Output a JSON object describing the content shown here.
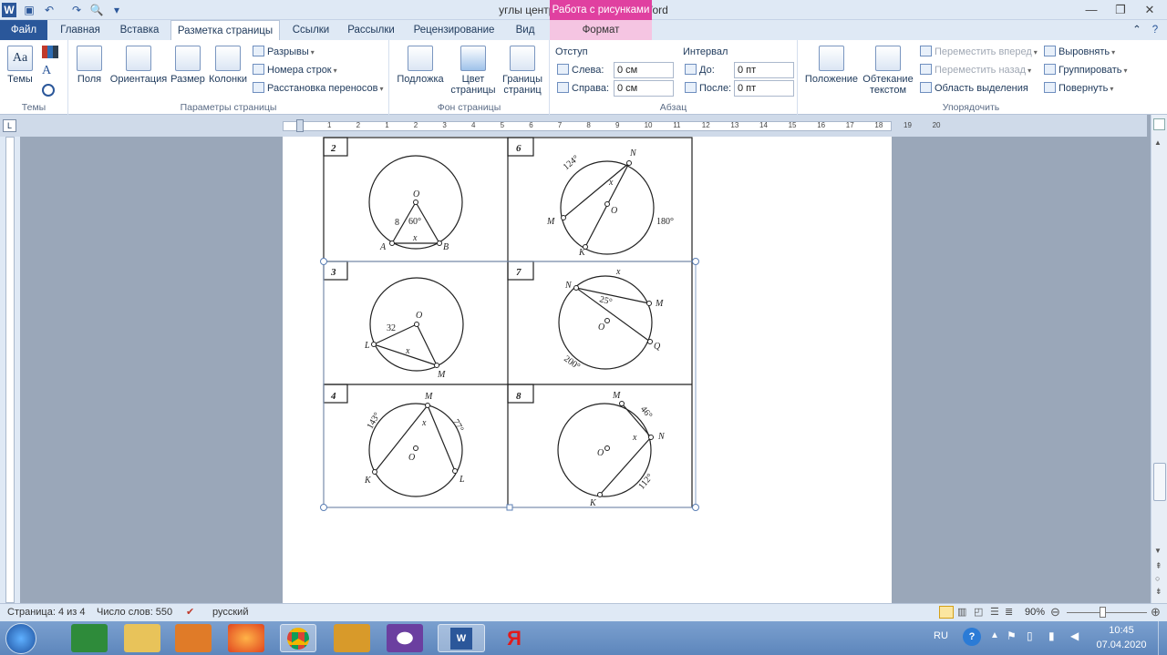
{
  "window": {
    "title": "углы централь. 8  -  Microsoft Word",
    "context_header": "Работа с рисунками"
  },
  "tabs": [
    "Файл",
    "Главная",
    "Вставка",
    "Разметка страницы",
    "Ссылки",
    "Рассылки",
    "Рецензирование",
    "Вид",
    "Формат"
  ],
  "ribbon": {
    "themes": {
      "themes_label": "Темы",
      "group": "Темы"
    },
    "page_setup": {
      "fields": "Поля",
      "orientation": "Ориентация",
      "size": "Размер",
      "columns": "Колонки",
      "breaks": "Разрывы",
      "line_numbers": "Номера строк",
      "hyphenation": "Расстановка переносов",
      "group": "Параметры страницы"
    },
    "page_background": {
      "watermark": "Подложка",
      "color1": "Цвет",
      "color2": "страницы",
      "borders1": "Границы",
      "borders2": "страниц",
      "group": "Фон страницы"
    },
    "paragraph": {
      "indent_title": "Отступ",
      "left_label": "Слева:",
      "left_value": "0 см",
      "right_label": "Справа:",
      "right_value": "0 см",
      "spacing_title": "Интервал",
      "before_label": "До:",
      "before_value": "0 пт",
      "after_label": "После:",
      "after_value": "0 пт",
      "group": "Абзац"
    },
    "arrange": {
      "position": "Положение",
      "wrap1": "Обтекание",
      "wrap2": "текстом",
      "bring_forward": "Переместить вперед",
      "send_backward": "Переместить назад",
      "selection_pane": "Область выделения",
      "align": "Выровнять",
      "group_cmd": "Группировать",
      "rotate": "Повернуть",
      "group": "Упорядочить"
    }
  },
  "ruler_numbers": [
    "1",
    "2",
    "1",
    "2",
    "3",
    "4",
    "5",
    "6",
    "7",
    "8",
    "9",
    "10",
    "11",
    "12",
    "13",
    "14",
    "15",
    "16",
    "17",
    "18",
    "19",
    "20"
  ],
  "figure": {
    "cells": [
      {
        "num": "2",
        "labels": {
          "O": "O",
          "A": "A",
          "B": "B",
          "x": "x",
          "side": "8",
          "angle": "60°"
        }
      },
      {
        "num": "6",
        "labels": {
          "N": "N",
          "M": "M",
          "K": "K",
          "O": "O",
          "x": "x",
          "arc1": "124°",
          "arc2": "180°"
        }
      },
      {
        "num": "3",
        "labels": {
          "O": "O",
          "L": "L",
          "M": "M",
          "x": "x",
          "side": "32"
        }
      },
      {
        "num": "7",
        "labels": {
          "N": "N",
          "M": "M",
          "Q": "Q",
          "O": "O",
          "x": "x",
          "angle": "25°",
          "arc": "200°"
        }
      },
      {
        "num": "4",
        "labels": {
          "M": "M",
          "K": "K",
          "L": "L",
          "O": "O",
          "x": "x",
          "arc1": "143°",
          "arc2": "77°"
        }
      },
      {
        "num": "8",
        "labels": {
          "M": "M",
          "N": "N",
          "K": "K",
          "O": "O",
          "x": "x",
          "arc1": "46°",
          "arc2": "112°"
        }
      }
    ]
  },
  "status": {
    "page": "Страница: 4 из 4",
    "words": "Число слов: 550",
    "lang": "русский",
    "zoom": "90%"
  },
  "taskbar": {
    "lang": "RU",
    "time": "10:45",
    "date": "07.04.2020"
  }
}
